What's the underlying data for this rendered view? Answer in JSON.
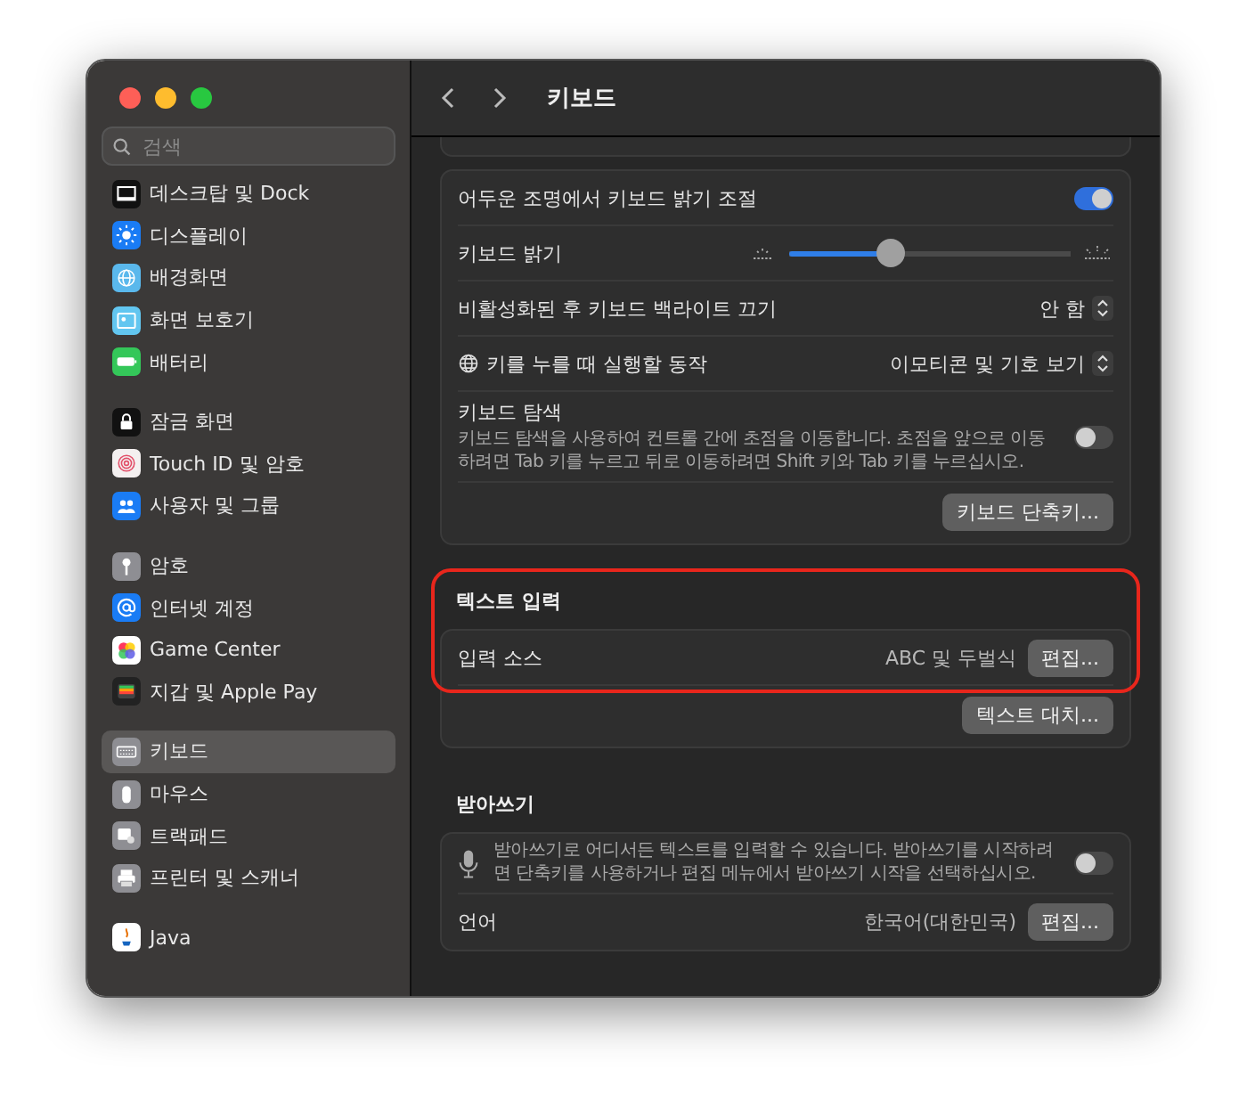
{
  "window": {
    "title": "키보드"
  },
  "sidebar": {
    "search": {
      "placeholder": "검색"
    },
    "groups": [
      [
        {
          "label": "데스크탑 및 Dock",
          "selected": false
        },
        {
          "label": "디스플레이",
          "selected": false
        },
        {
          "label": "배경화면",
          "selected": false
        },
        {
          "label": "화면 보호기",
          "selected": false
        },
        {
          "label": "배터리",
          "selected": false
        }
      ],
      [
        {
          "label": "잠금 화면",
          "selected": false
        },
        {
          "label": "Touch ID 및 암호",
          "selected": false
        },
        {
          "label": "사용자 및 그룹",
          "selected": false
        }
      ],
      [
        {
          "label": "암호",
          "selected": false
        },
        {
          "label": "인터넷 계정",
          "selected": false
        },
        {
          "label": "Game Center",
          "selected": false
        },
        {
          "label": "지갑 및 Apple Pay",
          "selected": false
        }
      ],
      [
        {
          "label": "키보드",
          "selected": true
        },
        {
          "label": "마우스",
          "selected": false
        },
        {
          "label": "트랙패드",
          "selected": false
        },
        {
          "label": "프린터 및 스캐너",
          "selected": false
        }
      ],
      [
        {
          "label": "Java",
          "selected": false
        }
      ]
    ]
  },
  "sections": [
    {
      "highlighted": false,
      "rows": [
        {
          "kind": "toggle",
          "label": "어두운 조명에서 키보드 밝기 조절",
          "on": true
        },
        {
          "kind": "slider",
          "label": "키보드 밝기",
          "level": 0.36
        },
        {
          "kind": "popup",
          "label": "비활성화된 후 키보드 백라이트 끄기",
          "value": "안 함"
        },
        {
          "kind": "popup",
          "label": "키를 누를 때 실행할 동작",
          "value": "이모티콘 및 기호 보기",
          "globe": true
        },
        {
          "kind": "toggle",
          "label": "키보드 탐색",
          "description": "키보드 탐색을 사용하여 컨트롤 간에 초점을 이동합니다. 초점을 앞으로 이동하려면 Tab 키를 누르고 뒤로 이동하려면 Shift 키와 Tab 키를 누르십시오.",
          "on": false
        },
        {
          "kind": "button",
          "button": "키보드 단축키..."
        }
      ]
    },
    {
      "title": "텍스트 입력",
      "highlighted": true,
      "rows": [
        {
          "kind": "value",
          "label": "입력 소스",
          "value": "ABC 및 두벌식",
          "button": "편집..."
        },
        {
          "kind": "button",
          "button": "텍스트 대치..."
        }
      ]
    },
    {
      "title": "받아쓰기",
      "highlighted": false,
      "rows": [
        {
          "kind": "toggle",
          "description": "받아쓰기로 어디서든 텍스트를 입력할 수 있습니다. 받아쓰기를 시작하려면 단축키를 사용하거나 편집 메뉴에서 받아쓰기 시작을 선택하십시오.",
          "on": false,
          "mic": true
        },
        {
          "kind": "value",
          "label": "언어",
          "value": "한국어(대한민국)",
          "button": "편집..."
        }
      ]
    }
  ]
}
